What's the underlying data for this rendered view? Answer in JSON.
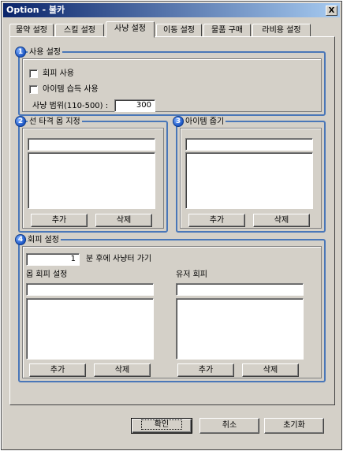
{
  "window": {
    "title": "Option - 불카",
    "close_glyph": "X"
  },
  "tabs": [
    "물약 설정",
    "스킬 설정",
    "사냥 설정",
    "이동 설정",
    "물품 구매",
    "라비용 설정"
  ],
  "active_tab": "사냥 설정",
  "accent_color": "#4a77b8",
  "usage": {
    "badge": "1",
    "title": "사용 설정",
    "checkbox_evade": "회피 사용",
    "checkbox_pickup": "아이템 습득 사용",
    "range_label": "사냥 범위(110-500) :",
    "range_value": "300"
  },
  "target_mob": {
    "badge": "2",
    "title": "선 타격 몹 지정",
    "add_label": "추가",
    "delete_label": "삭제"
  },
  "item_pickup": {
    "badge": "3",
    "title": "아이템 줍기",
    "add_label": "추가",
    "delete_label": "삭제"
  },
  "evade": {
    "badge": "4",
    "title": "회피 설정",
    "minutes_value": "1",
    "minutes_label": "분 후에 사냥터 가기",
    "mob_evade_title": "몹 회피 설정",
    "user_evade_title": "유저 회피",
    "add_label": "추가",
    "delete_label": "삭제"
  },
  "footer": {
    "ok_label": "확인",
    "cancel_label": "취소",
    "reset_label": "초기화"
  }
}
